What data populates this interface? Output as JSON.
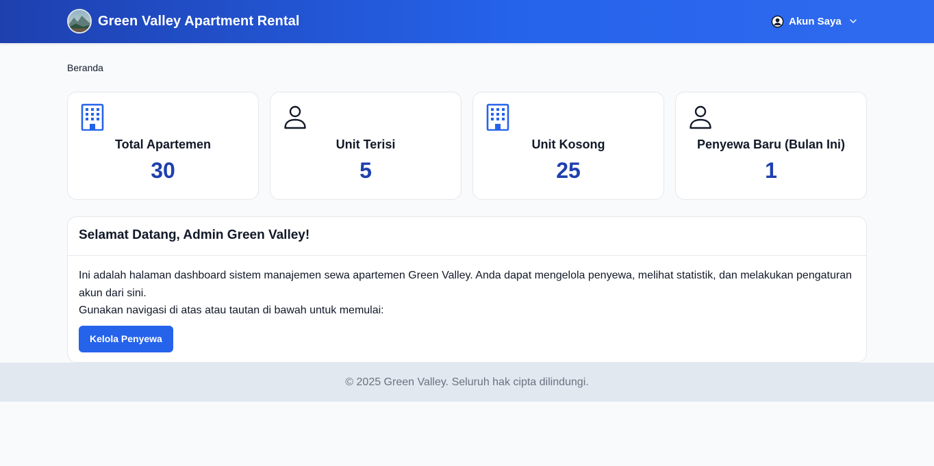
{
  "navbar": {
    "brand_title": "Green Valley Apartment Rental",
    "account_label": "Akun Saya"
  },
  "breadcrumb": "Beranda",
  "stats": [
    {
      "icon": "building-icon",
      "label": "Total Apartemen",
      "value": "30"
    },
    {
      "icon": "user-icon",
      "label": "Unit Terisi",
      "value": "5"
    },
    {
      "icon": "building-icon",
      "label": "Unit Kosong",
      "value": "25"
    },
    {
      "icon": "user-icon",
      "label": "Penyewa Baru (Bulan Ini)",
      "value": "1"
    }
  ],
  "welcome": {
    "title": "Selamat Datang, Admin Green Valley!",
    "paragraph1": "Ini adalah halaman dashboard sistem manajemen sewa apartemen Green Valley. Anda dapat mengelola penyewa, melihat statistik, dan melakukan pengaturan akun dari sini.",
    "paragraph2": "Gunakan navigasi di atas atau tautan di bawah untuk memulai:",
    "button_label": "Kelola Penyewa"
  },
  "footer": {
    "text": "© 2025 Green Valley. Seluruh hak cipta dilindungi."
  },
  "colors": {
    "navbar_start": "#1e40af",
    "navbar_end": "#2f6bf0",
    "accent": "#2563eb",
    "stat_value": "#1e40af",
    "background": "#f8fafc",
    "footer_bg": "#e2e8f0"
  }
}
